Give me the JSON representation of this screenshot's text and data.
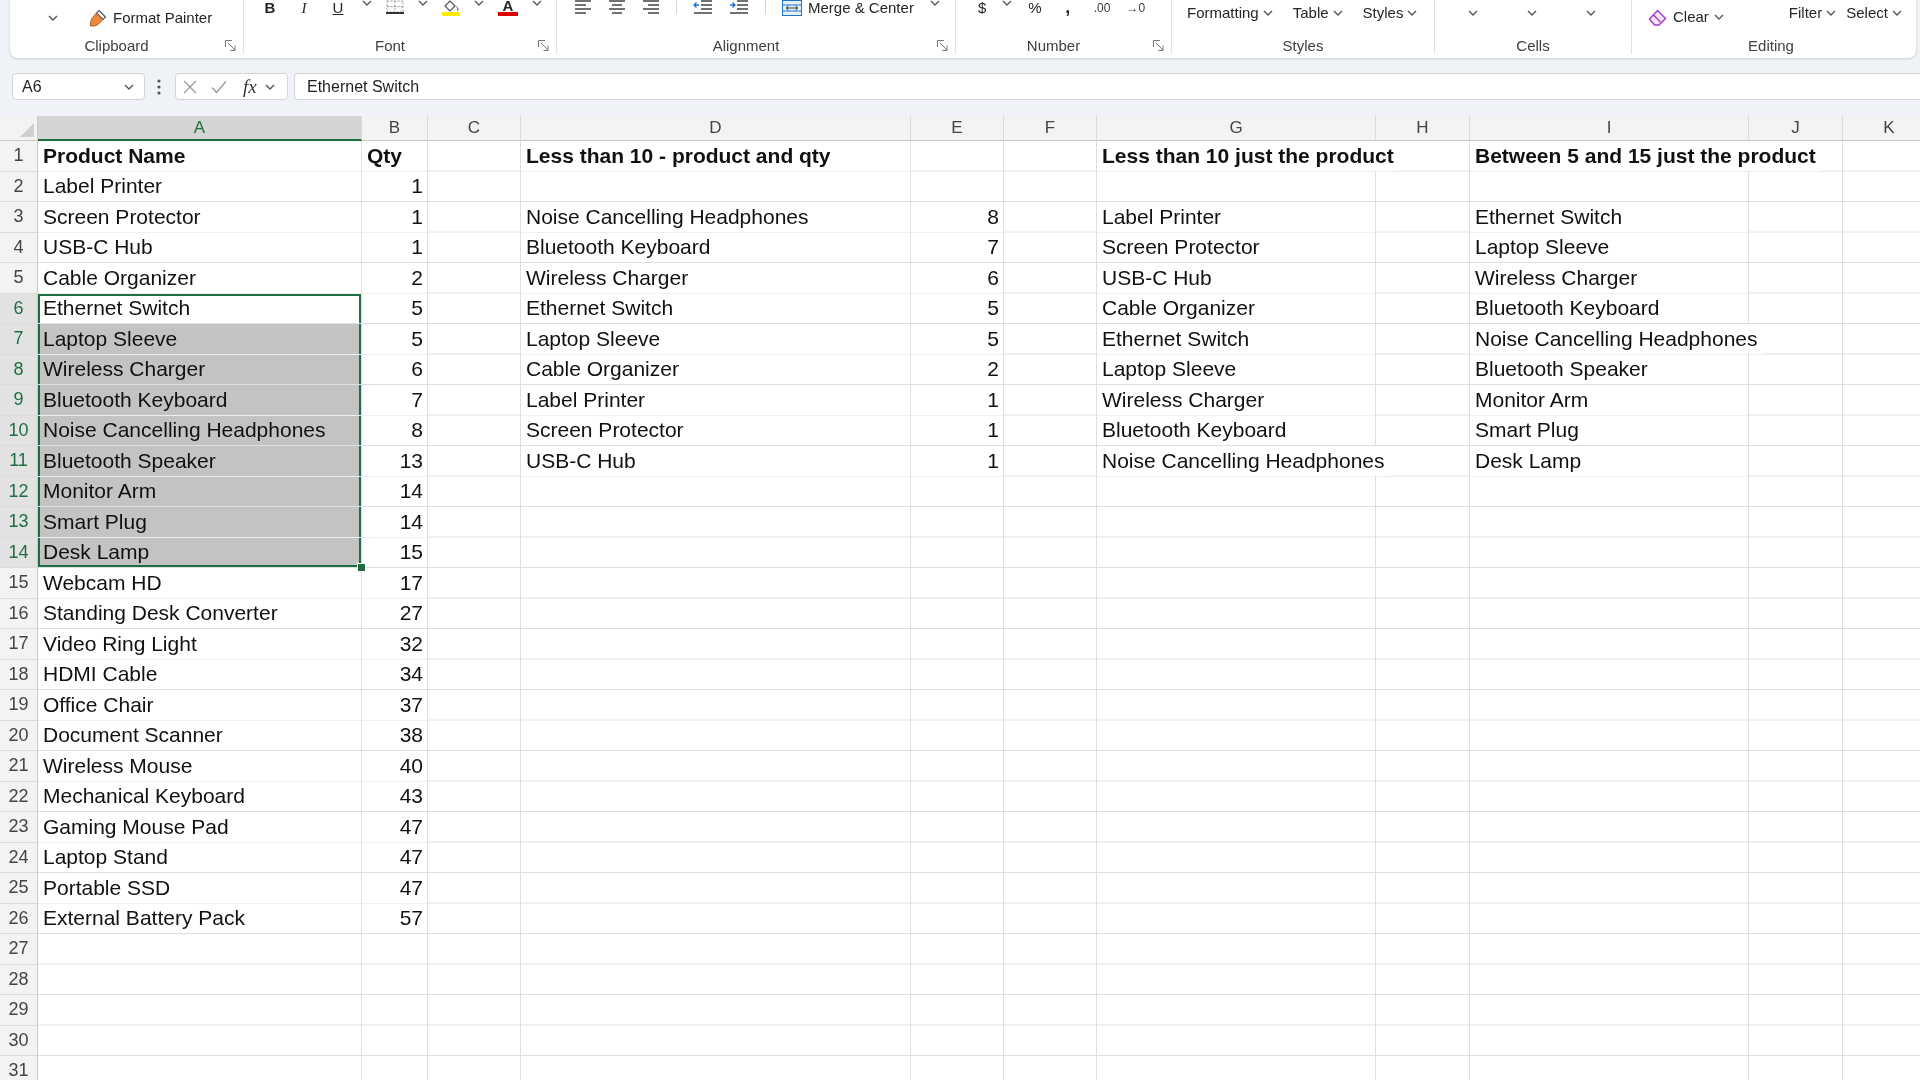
{
  "ribbon": {
    "groups": [
      {
        "kind": "clipboard",
        "label": "Clipboard",
        "format_painter": "Format Painter"
      },
      {
        "kind": "font",
        "label": "Font",
        "styles": [
          "B",
          "I",
          "U"
        ],
        "font_color": "A"
      },
      {
        "kind": "alignment",
        "label": "Alignment",
        "merge": "Merge & Center"
      },
      {
        "kind": "number",
        "label": "Number",
        "symbols": [
          "$",
          "%",
          ","
        ],
        "decimals": [
          ".00",
          "→0"
        ]
      },
      {
        "kind": "styles",
        "label": "Styles",
        "buttons": [
          "Formatting",
          "Table",
          "Styles"
        ]
      },
      {
        "kind": "cells",
        "label": "Cells"
      },
      {
        "kind": "editing",
        "label": "Editing",
        "clear": "Clear",
        "buttons": [
          "Filter",
          "Select"
        ]
      }
    ]
  },
  "formula_bar": {
    "name_box": "A6",
    "function_button": "fx",
    "formula": "Ethernet Switch"
  },
  "sheet": {
    "columns": [
      {
        "letter": "A",
        "selected": true
      },
      {
        "letter": "B",
        "selected": false
      },
      {
        "letter": "C",
        "selected": false
      },
      {
        "letter": "D",
        "selected": false
      },
      {
        "letter": "E",
        "selected": false
      },
      {
        "letter": "F",
        "selected": false
      },
      {
        "letter": "G",
        "selected": false
      },
      {
        "letter": "H",
        "selected": false
      },
      {
        "letter": "I",
        "selected": false
      },
      {
        "letter": "J",
        "selected": false
      },
      {
        "letter": "K",
        "selected": false
      }
    ],
    "rows": [
      {
        "number": "1",
        "selected": false,
        "cells": [
          {
            "text": "Product Name",
            "kind": "header",
            "selected": false,
            "active": false
          },
          {
            "text": "Qty",
            "kind": "header",
            "selected": false,
            "active": false
          },
          null,
          {
            "text": "Less than 10 - product and qty",
            "kind": "header",
            "selected": false,
            "active": false
          },
          null,
          null,
          {
            "text": "Less than 10 just the product",
            "kind": "header",
            "selected": false,
            "active": false
          },
          null,
          {
            "text": "Between 5 and 15 just the product",
            "kind": "header",
            "selected": false,
            "active": false
          }
        ]
      },
      {
        "number": "2",
        "selected": false,
        "cells": [
          {
            "text": "Label Printer",
            "kind": "text",
            "selected": false,
            "active": false
          },
          {
            "text": "1",
            "kind": "number",
            "selected": false,
            "active": false
          }
        ]
      },
      {
        "number": "3",
        "selected": false,
        "cells": [
          {
            "text": "Screen Protector",
            "kind": "text",
            "selected": false,
            "active": false
          },
          {
            "text": "1",
            "kind": "number",
            "selected": false,
            "active": false
          },
          null,
          {
            "text": "Noise Cancelling Headphones",
            "kind": "text",
            "selected": false,
            "active": false
          },
          {
            "text": "8",
            "kind": "number",
            "selected": false,
            "active": false
          },
          null,
          {
            "text": "Label Printer",
            "kind": "text",
            "selected": false,
            "active": false
          },
          null,
          {
            "text": "Ethernet Switch",
            "kind": "text",
            "selected": false,
            "active": false
          }
        ]
      },
      {
        "number": "4",
        "selected": false,
        "cells": [
          {
            "text": "USB-C Hub",
            "kind": "text",
            "selected": false,
            "active": false
          },
          {
            "text": "1",
            "kind": "number",
            "selected": false,
            "active": false
          },
          null,
          {
            "text": "Bluetooth Keyboard",
            "kind": "text",
            "selected": false,
            "active": false
          },
          {
            "text": "7",
            "kind": "number",
            "selected": false,
            "active": false
          },
          null,
          {
            "text": "Screen Protector",
            "kind": "text",
            "selected": false,
            "active": false
          },
          null,
          {
            "text": "Laptop Sleeve",
            "kind": "text",
            "selected": false,
            "active": false
          }
        ]
      },
      {
        "number": "5",
        "selected": false,
        "cells": [
          {
            "text": "Cable Organizer",
            "kind": "text",
            "selected": false,
            "active": false
          },
          {
            "text": "2",
            "kind": "number",
            "selected": false,
            "active": false
          },
          null,
          {
            "text": "Wireless Charger",
            "kind": "text",
            "selected": false,
            "active": false
          },
          {
            "text": "6",
            "kind": "number",
            "selected": false,
            "active": false
          },
          null,
          {
            "text": "USB-C Hub",
            "kind": "text",
            "selected": false,
            "active": false
          },
          null,
          {
            "text": "Wireless Charger",
            "kind": "text",
            "selected": false,
            "active": false
          }
        ]
      },
      {
        "number": "6",
        "selected": true,
        "cells": [
          {
            "text": "Ethernet Switch",
            "kind": "text",
            "selected": true,
            "active": true
          },
          {
            "text": "5",
            "kind": "number",
            "selected": false,
            "active": false
          },
          null,
          {
            "text": "Ethernet Switch",
            "kind": "text",
            "selected": false,
            "active": false
          },
          {
            "text": "5",
            "kind": "number",
            "selected": false,
            "active": false
          },
          null,
          {
            "text": "Cable Organizer",
            "kind": "text",
            "selected": false,
            "active": false
          },
          null,
          {
            "text": "Bluetooth Keyboard",
            "kind": "text",
            "selected": false,
            "active": false
          }
        ]
      },
      {
        "number": "7",
        "selected": true,
        "cells": [
          {
            "text": "Laptop Sleeve",
            "kind": "text",
            "selected": true,
            "active": false
          },
          {
            "text": "5",
            "kind": "number",
            "selected": false,
            "active": false
          },
          null,
          {
            "text": "Laptop Sleeve",
            "kind": "text",
            "selected": false,
            "active": false
          },
          {
            "text": "5",
            "kind": "number",
            "selected": false,
            "active": false
          },
          null,
          {
            "text": "Ethernet Switch",
            "kind": "text",
            "selected": false,
            "active": false
          },
          null,
          {
            "text": "Noise Cancelling Headphones",
            "kind": "text",
            "selected": false,
            "active": false
          }
        ]
      },
      {
        "number": "8",
        "selected": true,
        "cells": [
          {
            "text": "Wireless Charger",
            "kind": "text",
            "selected": true,
            "active": false
          },
          {
            "text": "6",
            "kind": "number",
            "selected": false,
            "active": false
          },
          null,
          {
            "text": "Cable Organizer",
            "kind": "text",
            "selected": false,
            "active": false
          },
          {
            "text": "2",
            "kind": "number",
            "selected": false,
            "active": false
          },
          null,
          {
            "text": "Laptop Sleeve",
            "kind": "text",
            "selected": false,
            "active": false
          },
          null,
          {
            "text": "Bluetooth Speaker",
            "kind": "text",
            "selected": false,
            "active": false
          }
        ]
      },
      {
        "number": "9",
        "selected": true,
        "cells": [
          {
            "text": "Bluetooth Keyboard",
            "kind": "text",
            "selected": true,
            "active": false
          },
          {
            "text": "7",
            "kind": "number",
            "selected": false,
            "active": false
          },
          null,
          {
            "text": "Label Printer",
            "kind": "text",
            "selected": false,
            "active": false
          },
          {
            "text": "1",
            "kind": "number",
            "selected": false,
            "active": false
          },
          null,
          {
            "text": "Wireless Charger",
            "kind": "text",
            "selected": false,
            "active": false
          },
          null,
          {
            "text": "Monitor Arm",
            "kind": "text",
            "selected": false,
            "active": false
          }
        ]
      },
      {
        "number": "10",
        "selected": true,
        "cells": [
          {
            "text": "Noise Cancelling Headphones",
            "kind": "text",
            "selected": true,
            "active": false
          },
          {
            "text": "8",
            "kind": "number",
            "selected": false,
            "active": false
          },
          null,
          {
            "text": "Screen Protector",
            "kind": "text",
            "selected": false,
            "active": false
          },
          {
            "text": "1",
            "kind": "number",
            "selected": false,
            "active": false
          },
          null,
          {
            "text": "Bluetooth Keyboard",
            "kind": "text",
            "selected": false,
            "active": false
          },
          null,
          {
            "text": "Smart Plug",
            "kind": "text",
            "selected": false,
            "active": false
          }
        ]
      },
      {
        "number": "11",
        "selected": true,
        "cells": [
          {
            "text": "Bluetooth Speaker",
            "kind": "text",
            "selected": true,
            "active": false
          },
          {
            "text": "13",
            "kind": "number",
            "selected": false,
            "active": false
          },
          null,
          {
            "text": "USB-C Hub",
            "kind": "text",
            "selected": false,
            "active": false
          },
          {
            "text": "1",
            "kind": "number",
            "selected": false,
            "active": false
          },
          null,
          {
            "text": "Noise Cancelling Headphones",
            "kind": "text",
            "selected": false,
            "active": false
          },
          null,
          {
            "text": "Desk Lamp",
            "kind": "text",
            "selected": false,
            "active": false
          }
        ]
      },
      {
        "number": "12",
        "selected": true,
        "cells": [
          {
            "text": "Monitor Arm",
            "kind": "text",
            "selected": true,
            "active": false
          },
          {
            "text": "14",
            "kind": "number",
            "selected": false,
            "active": false
          }
        ]
      },
      {
        "number": "13",
        "selected": true,
        "cells": [
          {
            "text": "Smart Plug",
            "kind": "text",
            "selected": true,
            "active": false
          },
          {
            "text": "14",
            "kind": "number",
            "selected": false,
            "active": false
          }
        ]
      },
      {
        "number": "14",
        "selected": true,
        "cells": [
          {
            "text": "Desk Lamp",
            "kind": "text",
            "selected": true,
            "active": false
          },
          {
            "text": "15",
            "kind": "number",
            "selected": false,
            "active": false
          }
        ]
      },
      {
        "number": "15",
        "selected": false,
        "cells": [
          {
            "text": "Webcam HD",
            "kind": "text",
            "selected": false,
            "active": false
          },
          {
            "text": "17",
            "kind": "number",
            "selected": false,
            "active": false
          }
        ]
      },
      {
        "number": "16",
        "selected": false,
        "cells": [
          {
            "text": "Standing Desk Converter",
            "kind": "text",
            "selected": false,
            "active": false
          },
          {
            "text": "27",
            "kind": "number",
            "selected": false,
            "active": false
          }
        ]
      },
      {
        "number": "17",
        "selected": false,
        "cells": [
          {
            "text": "Video Ring Light",
            "kind": "text",
            "selected": false,
            "active": false
          },
          {
            "text": "32",
            "kind": "number",
            "selected": false,
            "active": false
          }
        ]
      },
      {
        "number": "18",
        "selected": false,
        "cells": [
          {
            "text": "HDMI Cable",
            "kind": "text",
            "selected": false,
            "active": false
          },
          {
            "text": "34",
            "kind": "number",
            "selected": false,
            "active": false
          }
        ]
      },
      {
        "number": "19",
        "selected": false,
        "cells": [
          {
            "text": "Office Chair",
            "kind": "text",
            "selected": false,
            "active": false
          },
          {
            "text": "37",
            "kind": "number",
            "selected": false,
            "active": false
          }
        ]
      },
      {
        "number": "20",
        "selected": false,
        "cells": [
          {
            "text": "Document Scanner",
            "kind": "text",
            "selected": false,
            "active": false
          },
          {
            "text": "38",
            "kind": "number",
            "selected": false,
            "active": false
          }
        ]
      },
      {
        "number": "21",
        "selected": false,
        "cells": [
          {
            "text": "Wireless Mouse",
            "kind": "text",
            "selected": false,
            "active": false
          },
          {
            "text": "40",
            "kind": "number",
            "selected": false,
            "active": false
          }
        ]
      },
      {
        "number": "22",
        "selected": false,
        "cells": [
          {
            "text": "Mechanical Keyboard",
            "kind": "text",
            "selected": false,
            "active": false
          },
          {
            "text": "43",
            "kind": "number",
            "selected": false,
            "active": false
          }
        ]
      },
      {
        "number": "23",
        "selected": false,
        "cells": [
          {
            "text": "Gaming Mouse Pad",
            "kind": "text",
            "selected": false,
            "active": false
          },
          {
            "text": "47",
            "kind": "number",
            "selected": false,
            "active": false
          }
        ]
      },
      {
        "number": "24",
        "selected": false,
        "cells": [
          {
            "text": "Laptop Stand",
            "kind": "text",
            "selected": false,
            "active": false
          },
          {
            "text": "47",
            "kind": "number",
            "selected": false,
            "active": false
          }
        ]
      },
      {
        "number": "25",
        "selected": false,
        "cells": [
          {
            "text": "Portable SSD",
            "kind": "text",
            "selected": false,
            "active": false
          },
          {
            "text": "47",
            "kind": "number",
            "selected": false,
            "active": false
          }
        ]
      },
      {
        "number": "26",
        "selected": false,
        "cells": [
          {
            "text": "External Battery Pack",
            "kind": "text",
            "selected": false,
            "active": false
          },
          {
            "text": "57",
            "kind": "number",
            "selected": false,
            "active": false
          }
        ]
      },
      {
        "number": "27",
        "selected": false
      },
      {
        "number": "28",
        "selected": false
      },
      {
        "number": "29",
        "selected": false
      },
      {
        "number": "30",
        "selected": false
      },
      {
        "number": "31",
        "selected": false
      }
    ]
  }
}
